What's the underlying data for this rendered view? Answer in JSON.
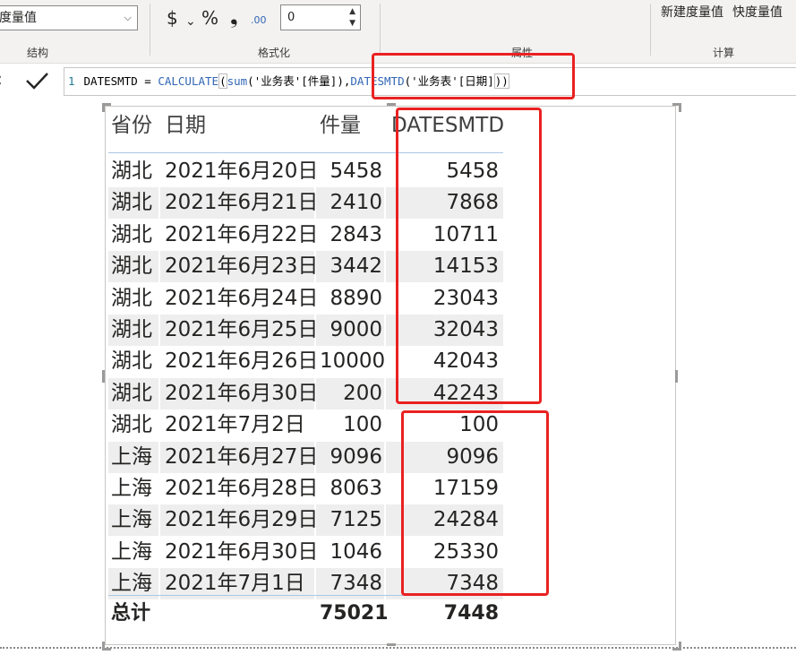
{
  "ribbon": {
    "structure": {
      "measure_value": "度量值",
      "label": "结构"
    },
    "formatting": {
      "currency": "$",
      "chevron": "⌄",
      "percent": "%",
      "comma": "❟",
      "decimal_shift": ".00",
      "decimal_places": "0",
      "label": "格式化"
    },
    "properties": {
      "label": "属性"
    },
    "calculations": {
      "new_measure": "新建度量值",
      "quick_measure": "快度量值",
      "label": "计算"
    }
  },
  "formula_bar": {
    "cancel_icon": "‹",
    "line_number": "1",
    "parts": {
      "p1": "DATESMTD = ",
      "p2": "CALCULATE",
      "p3": "(",
      "p4": "sum",
      "p5": "('",
      "p6": "业务表",
      "p7": "'[件量]",
      "p8": ")",
      "p9": ",",
      "p10": "DATESMTD",
      "p11": "('",
      "p12": "业务表",
      "p13": "'[日期]",
      "p14": "))"
    }
  },
  "table": {
    "headers": {
      "province": "省份",
      "date": "日期",
      "qty": "件量",
      "mtd": "DATESMTD"
    },
    "rows": [
      {
        "province": "湖北",
        "date": "2021年6月20日",
        "qty": "5458",
        "mtd": "5458"
      },
      {
        "province": "湖北",
        "date": "2021年6月21日",
        "qty": "2410",
        "mtd": "7868"
      },
      {
        "province": "湖北",
        "date": "2021年6月22日",
        "qty": "2843",
        "mtd": "10711"
      },
      {
        "province": "湖北",
        "date": "2021年6月23日",
        "qty": "3442",
        "mtd": "14153"
      },
      {
        "province": "湖北",
        "date": "2021年6月24日",
        "qty": "8890",
        "mtd": "23043"
      },
      {
        "province": "湖北",
        "date": "2021年6月25日",
        "qty": "9000",
        "mtd": "32043"
      },
      {
        "province": "湖北",
        "date": "2021年6月26日",
        "qty": "10000",
        "mtd": "42043"
      },
      {
        "province": "湖北",
        "date": "2021年6月30日",
        "qty": "200",
        "mtd": "42243"
      },
      {
        "province": "湖北",
        "date": "2021年7月2日",
        "qty": "100",
        "mtd": "100"
      },
      {
        "province": "上海",
        "date": "2021年6月27日",
        "qty": "9096",
        "mtd": "9096"
      },
      {
        "province": "上海",
        "date": "2021年6月28日",
        "qty": "8063",
        "mtd": "17159"
      },
      {
        "province": "上海",
        "date": "2021年6月29日",
        "qty": "7125",
        "mtd": "24284"
      },
      {
        "province": "上海",
        "date": "2021年6月30日",
        "qty": "1046",
        "mtd": "25330"
      },
      {
        "province": "上海",
        "date": "2021年7月1日",
        "qty": "7348",
        "mtd": "7348"
      }
    ],
    "total": {
      "label": "总计",
      "qty": "75021",
      "mtd": "7448"
    }
  },
  "colors": {
    "annotation": "#ea2121",
    "dax_function": "#3165b5",
    "dax_string": "#a31515",
    "row_alt": "#eeeeee"
  }
}
